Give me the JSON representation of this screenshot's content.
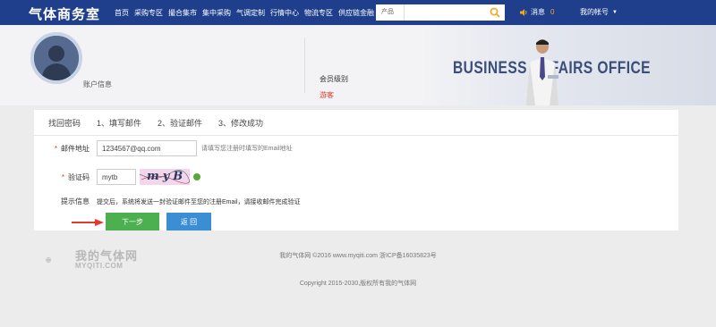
{
  "header": {
    "brand": "气体商务室",
    "nav": [
      "首页",
      "采购专区",
      "撮合集市",
      "集中采购",
      "气调定制",
      "行情中心",
      "物流专区",
      "供应链金融"
    ],
    "search": {
      "category": "产品",
      "placeholder": ""
    },
    "messages": {
      "label": "消息",
      "count": "0"
    },
    "account": "我的帐号"
  },
  "banner": {
    "account_info": "账户信息",
    "level_label": "会员级别",
    "level_value": "游客",
    "slogan": "BUSINESS AFFAIRS OFFICE"
  },
  "steps": [
    "找回密码",
    "1、填写邮件",
    "2、验证邮件",
    "3、修改成功"
  ],
  "form": {
    "email_label": "邮件地址",
    "email_value": "1234567@qq.com",
    "email_hint": "请填写您注册时填写的Email地址",
    "code_label": "验证码",
    "code_value": "mytb",
    "captcha_text": "myB",
    "tip_label": "提示信息",
    "tip_text": "提交后，系统将发送一封验证邮件至您的注册Email，请接收邮件完成验证",
    "next_button": "下一步",
    "back_button": "返 回"
  },
  "footer": {
    "logo_text": "我的气体网",
    "logo_sub": "MYQITI.COM",
    "line1": "我的气体网 ©2016 www.myqiti.com 浙ICP备16035823号",
    "line2": "Copyright 2015-2030,版权所有我的气体网"
  },
  "colors": {
    "header_bg": "#1f3f8c",
    "accent_red": "#e03b2e",
    "next_green": "#4caf50",
    "back_blue": "#3b8ed4",
    "search_orange": "#f5a623"
  }
}
